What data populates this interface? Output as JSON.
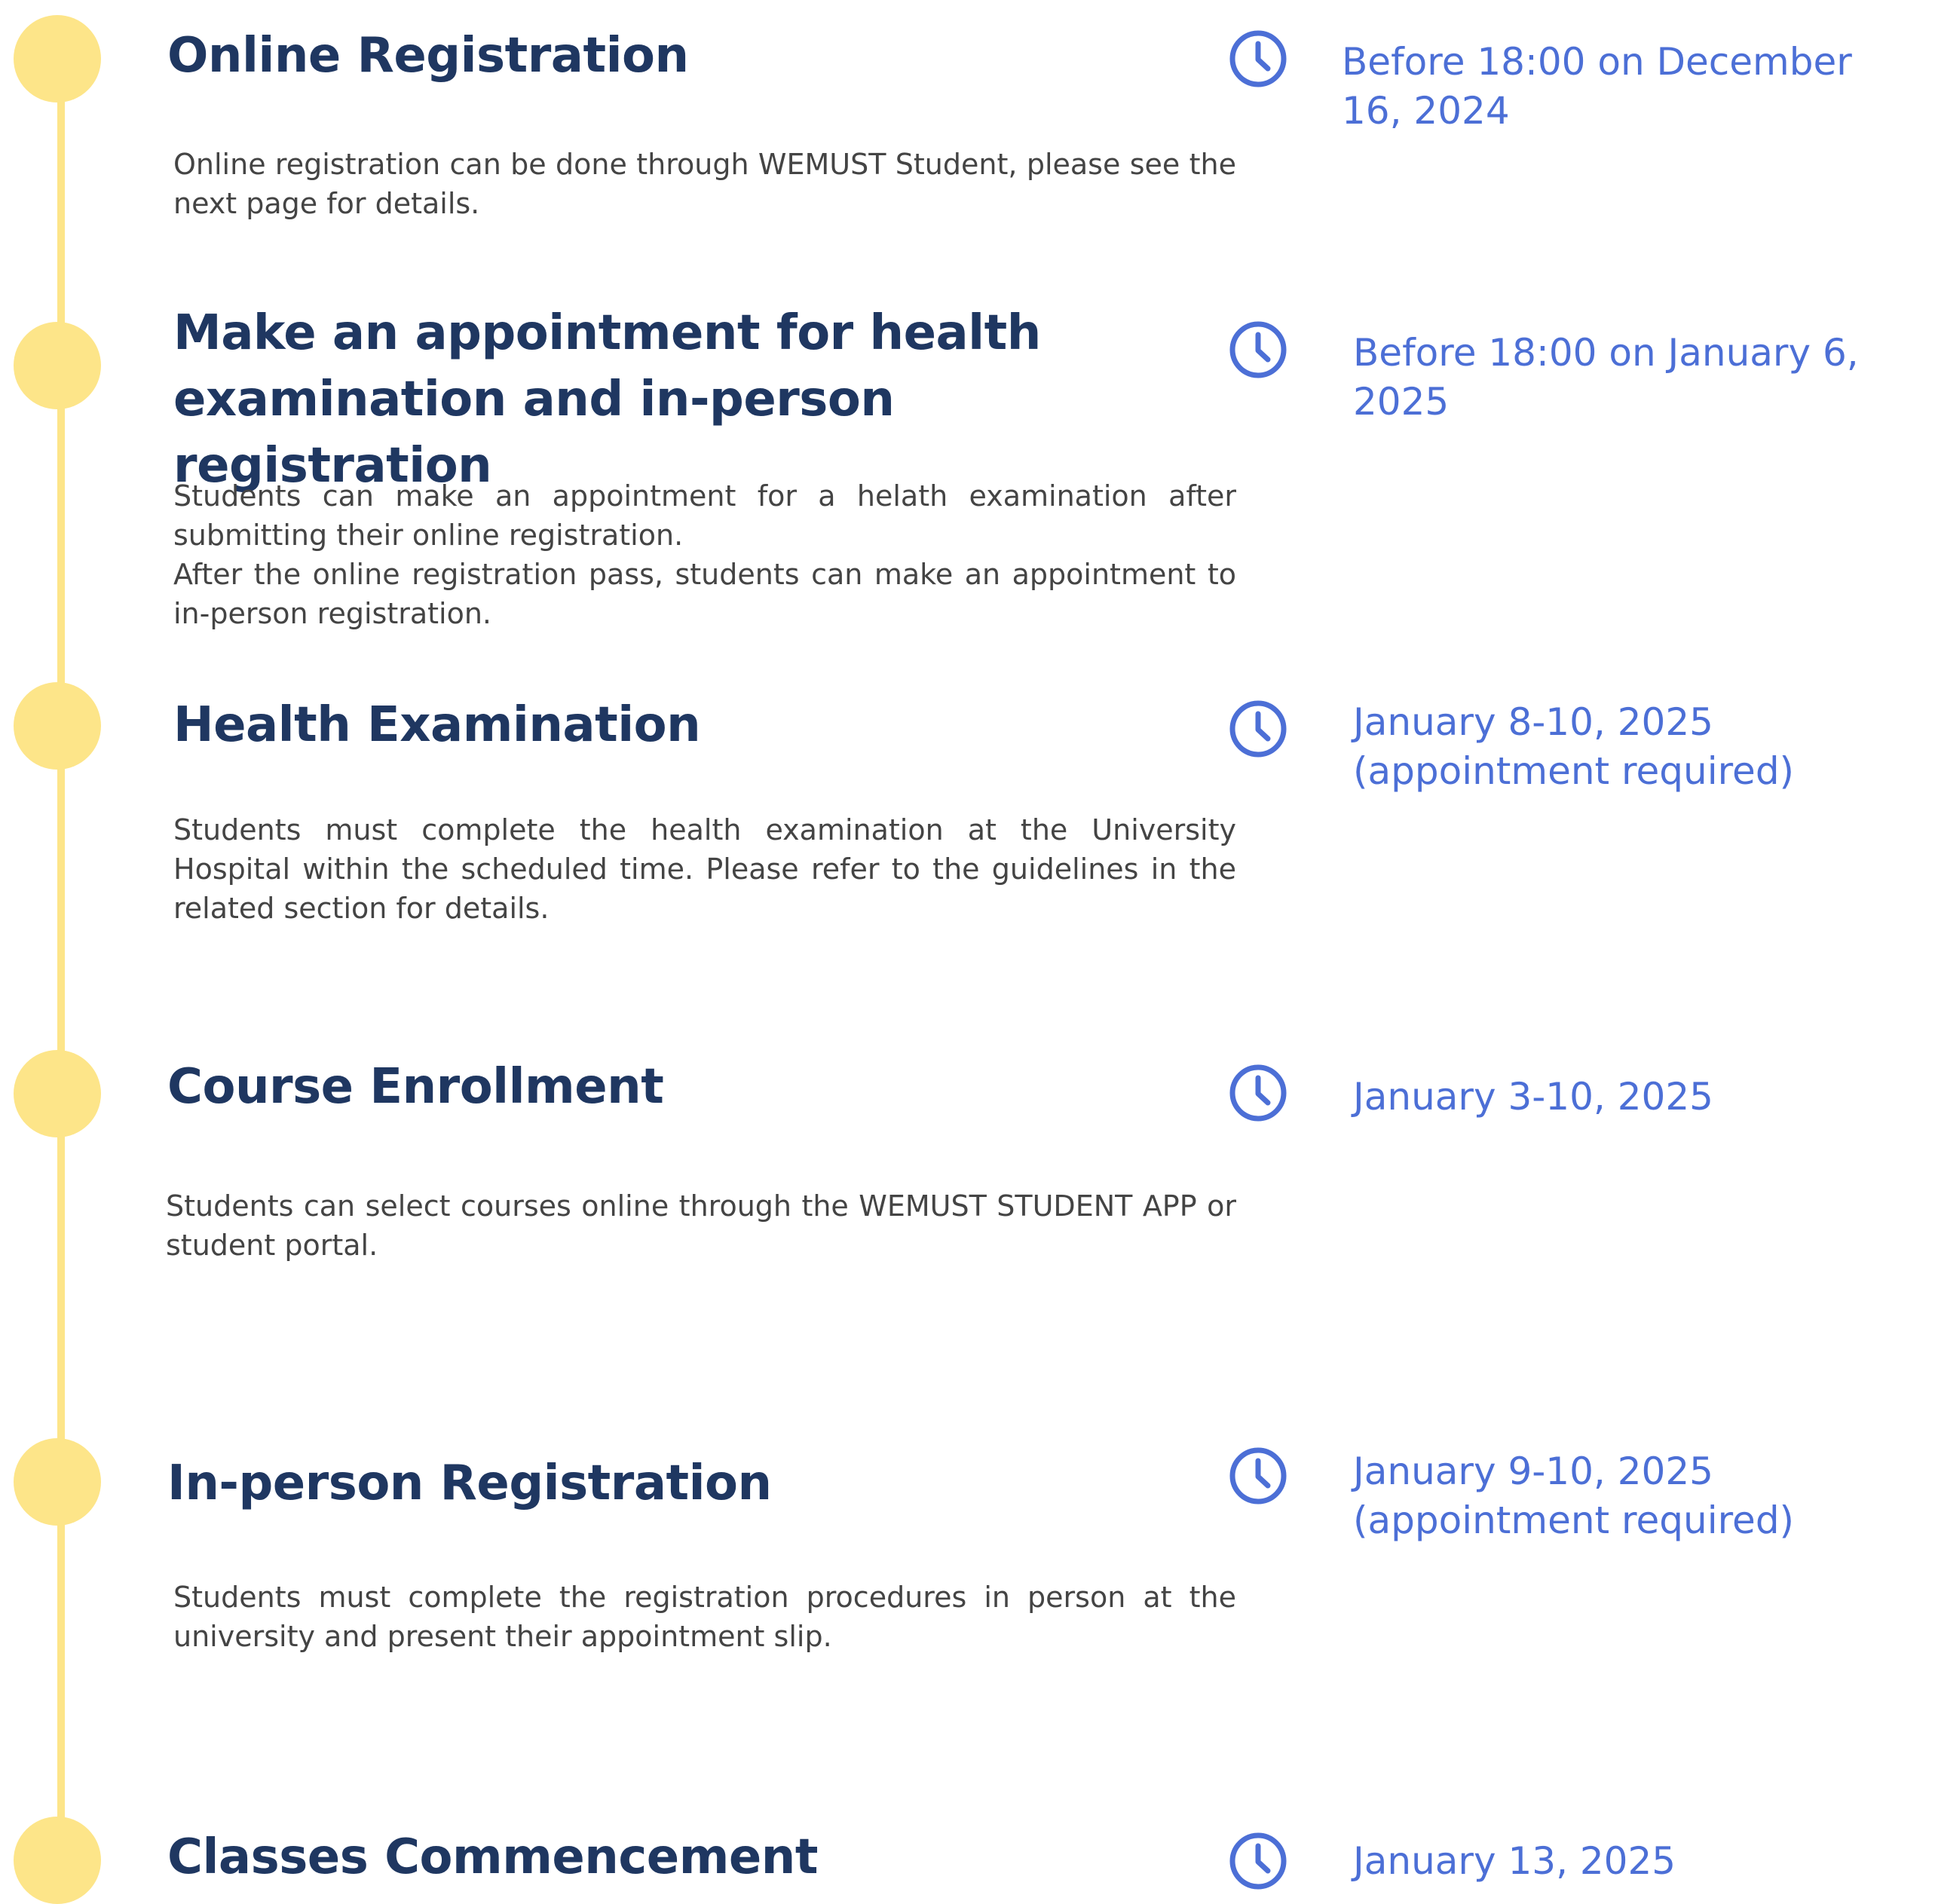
{
  "timeline": {
    "steps": [
      {
        "title": "Online Registration",
        "description": [
          "Online registration can be done through WEMUST Student, please see the next page for details."
        ],
        "date": "Before 18:00 on December 16, 2024"
      },
      {
        "title": "Make an appointment for health examination and in-person registration",
        "description": [
          "Students can make an appointment for a helath examination after submitting their online registration.",
          "After the online registration pass, students can make an appointment to in-person registration."
        ],
        "date": "Before 18:00 on January 6, 2025"
      },
      {
        "title": "Health Examination",
        "description": [
          "Students must complete the health examination at the University Hospital within the scheduled time. Please refer to the guidelines in the related section for details."
        ],
        "date": "January 8-10, 2025\n(appointment required)"
      },
      {
        "title": "Course Enrollment",
        "description": [
          "Students can select courses online through the WEMUST STUDENT APP or student portal."
        ],
        "date": "January 3-10, 2025"
      },
      {
        "title": "In-person Registration",
        "description": [
          "Students must complete the registration procedures in person at the university and present their appointment slip."
        ],
        "date": "January 9-10, 2025\n(appointment required)"
      },
      {
        "title": "Classes Commencement",
        "description": [],
        "date": "January 13, 2025"
      }
    ]
  },
  "colors": {
    "accent_yellow": "#fde589",
    "title_navy": "#1f3761",
    "date_blue": "#4c6fd6",
    "body_gray": "#444444"
  },
  "icons": {
    "timeline_marker": "circle-dot",
    "date_icon": "clock-icon"
  }
}
